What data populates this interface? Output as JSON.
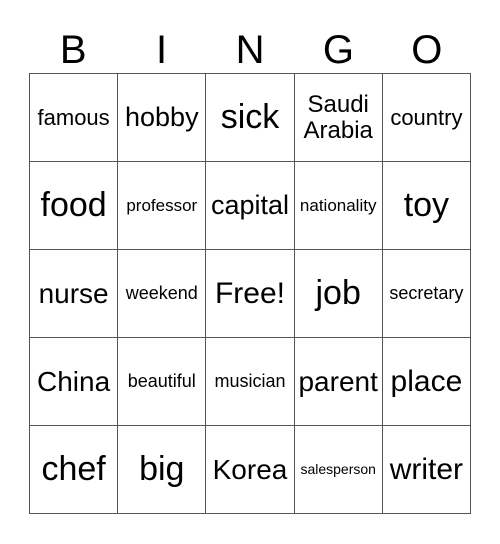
{
  "header": [
    "B",
    "I",
    "N",
    "G",
    "O"
  ],
  "cells": [
    [
      "famous",
      "hobby",
      "sick",
      "Saudi Arabia",
      "country"
    ],
    [
      "food",
      "professor",
      "capital",
      "nationality",
      "toy"
    ],
    [
      "nurse",
      "weekend",
      "Free!",
      "job",
      "secretary"
    ],
    [
      "China",
      "beautiful",
      "musician",
      "parent",
      "place"
    ],
    [
      "chef",
      "big",
      "Korea",
      "salesperson",
      "writer"
    ]
  ]
}
